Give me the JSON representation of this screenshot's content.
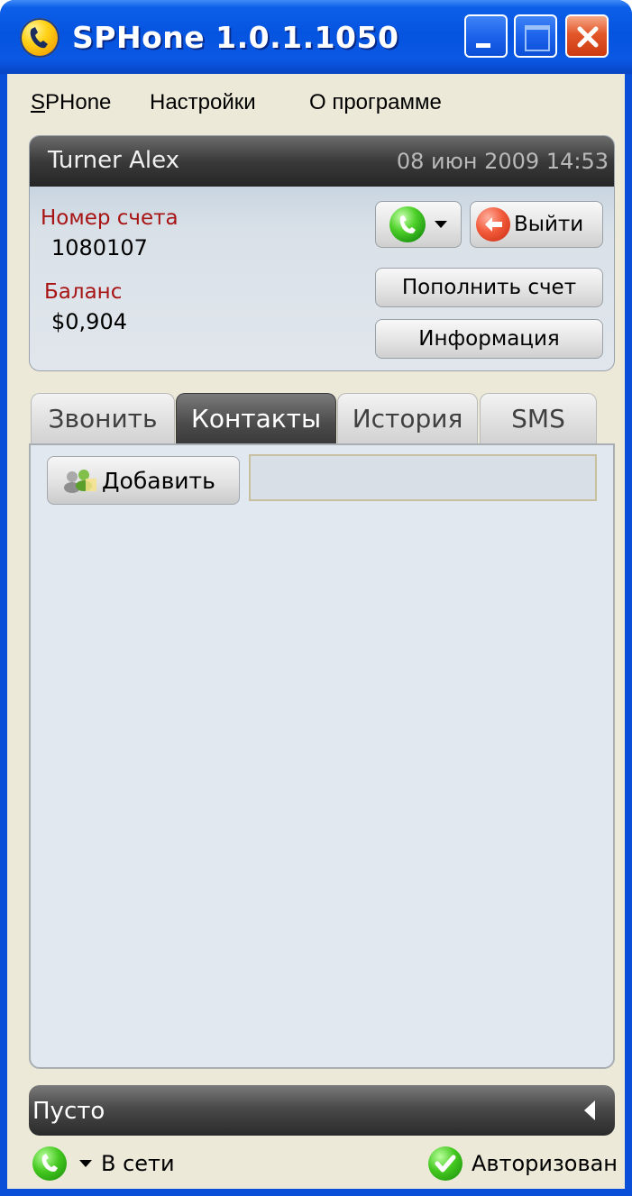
{
  "window": {
    "title": "SPHone 1.0.1.1050"
  },
  "menu": {
    "items": [
      {
        "label": "SPHone",
        "accel": "S",
        "rest": "PHone"
      },
      {
        "label": "Настройки"
      },
      {
        "label": "О программе"
      }
    ]
  },
  "account": {
    "user_name": "Turner Alex",
    "datetime": "08 июн 2009 14:53",
    "account_number_label": "Номер счета",
    "account_number": "1080107",
    "balance_label": "Баланс",
    "balance": "$0,904",
    "logout_label": "Выйти",
    "topup_label": "Пополнить счет",
    "info_label": "Информация"
  },
  "tabs": [
    {
      "label": "Звонить",
      "active": false
    },
    {
      "label": "Контакты",
      "active": true
    },
    {
      "label": "История",
      "active": false
    },
    {
      "label": "SMS",
      "active": false
    }
  ],
  "contacts": {
    "add_label": "Добавить",
    "search_value": ""
  },
  "bottom_bar": {
    "text": "Пусто"
  },
  "status": {
    "presence": "В сети",
    "auth": "Авторизован"
  },
  "colors": {
    "titlebar": "#0554e0",
    "label_red": "#a81414",
    "client_bg": "#ece9d8",
    "content_bg": "#e1e8ef",
    "dark_header": "#3a3a3a"
  },
  "icons": {
    "app": "phone-handset-icon",
    "call": "phone-call-icon",
    "logout": "logout-arrow-icon",
    "add_contact": "add-contacts-icon",
    "collapse": "collapse-arrow-icon",
    "presence": "online-status-icon",
    "auth": "checkmark-icon"
  }
}
